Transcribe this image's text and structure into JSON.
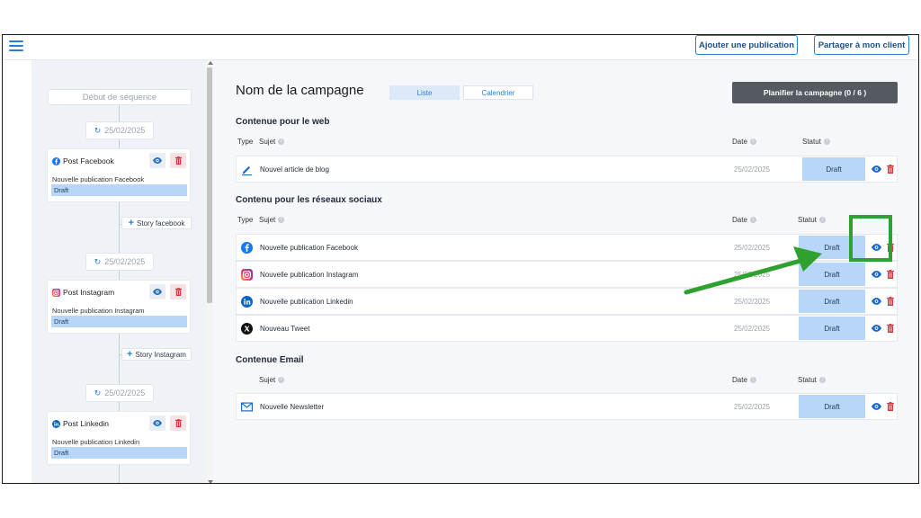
{
  "topbar": {
    "add_publication": "Ajouter une publication",
    "share_client": "Partager à mon client"
  },
  "sidebar": {
    "sequence_start": "Début de séquence",
    "dates": [
      "25/02/2025",
      "25/02/2025",
      "25/02/2025"
    ],
    "posts": [
      {
        "title": "Post Facebook",
        "subtitle": "Nouvelle publication Facebook",
        "status": "Draft",
        "icon": "facebook-icon"
      },
      {
        "title": "Post Instagram",
        "subtitle": "Nouvelle publication Instagram",
        "status": "Draft",
        "icon": "instagram-icon"
      },
      {
        "title": "Post Linkedin",
        "subtitle": "Nouvelle publication Linkedin",
        "status": "Draft",
        "icon": "linkedin-icon"
      }
    ],
    "stories": [
      "Story facebook",
      "Story Instagram"
    ]
  },
  "main": {
    "campaign_title": "Nom de la campagne",
    "tab_list": "Liste",
    "tab_calendar": "Calendrier",
    "plan_button": "Planifier la campagne (0 / 6 )",
    "columns": {
      "type": "Type",
      "subject": "Sujet",
      "date": "Date",
      "status": "Statut"
    },
    "sections": {
      "web": {
        "title": "Contenue pour le web",
        "rows": [
          {
            "subject": "Nouvel article de blog",
            "date": "25/02/2025",
            "status": "Draft",
            "icon": "pencil-icon"
          }
        ]
      },
      "social": {
        "title": "Contenu pour les réseaux sociaux",
        "rows": [
          {
            "subject": "Nouvelle publication Facebook",
            "date": "25/02/2025",
            "status": "Draft",
            "icon": "facebook-icon"
          },
          {
            "subject": "Nouvelle publication Instagram",
            "date": "25/02/2025",
            "status": "Draft",
            "icon": "instagram-icon"
          },
          {
            "subject": "Nouvelle publication Linkedin",
            "date": "25/02/2025",
            "status": "Draft",
            "icon": "linkedin-icon"
          },
          {
            "subject": "Nouveau Tweet",
            "date": "25/02/2025",
            "status": "Draft",
            "icon": "x-icon"
          }
        ]
      },
      "email": {
        "title": "Contenue Email",
        "rows": [
          {
            "subject": "Nouvelle Newsletter",
            "date": "25/02/2025",
            "status": "Draft",
            "icon": "mail-icon"
          }
        ]
      }
    }
  },
  "colors": {
    "accent": "#2a7fd4",
    "status_fill": "#b8d6f7",
    "delete": "#d9353f",
    "annotation": "#2ea12e"
  }
}
